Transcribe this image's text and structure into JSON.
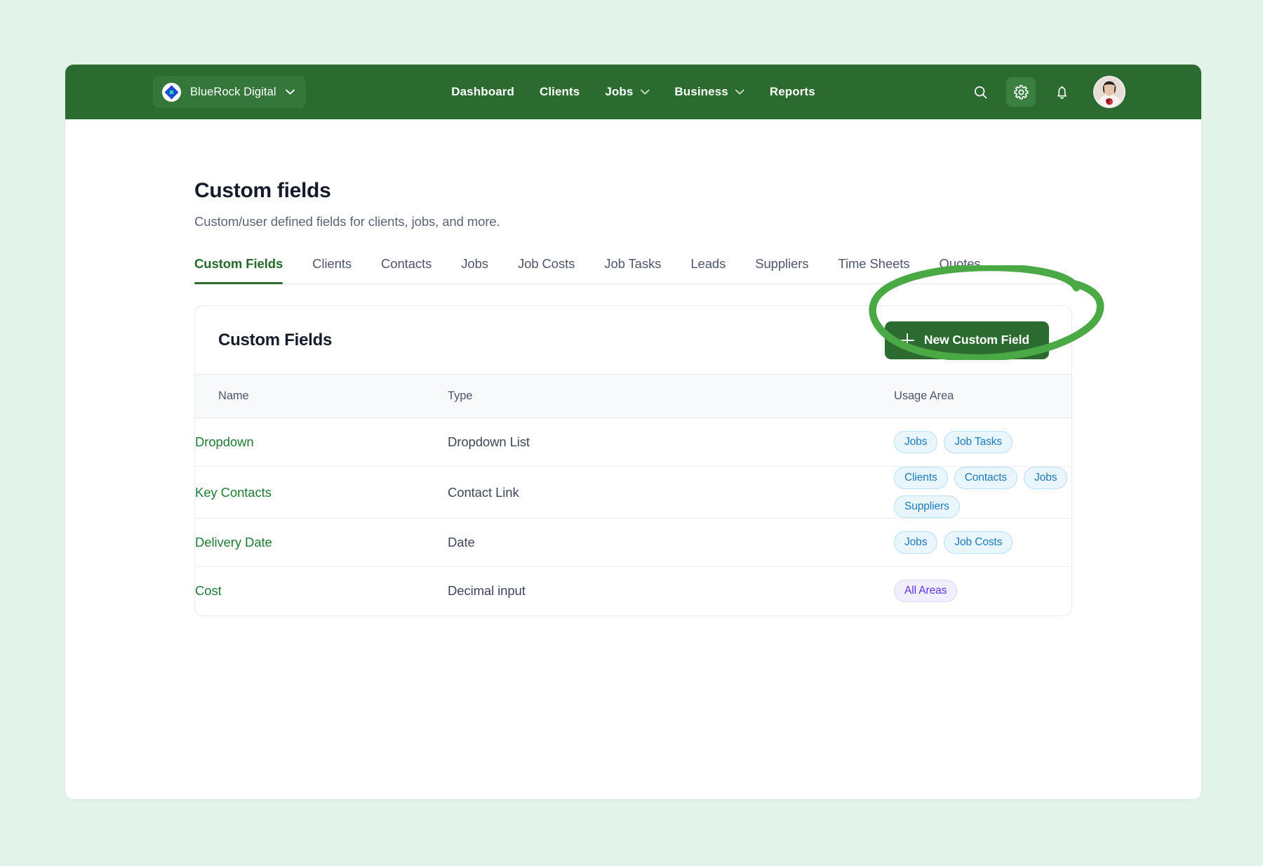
{
  "topbar": {
    "org": {
      "name": "BlueRock Digital",
      "chevron_icon": "chevron-down-icon",
      "logo_icon": "bluerock-logo-icon"
    },
    "nav": [
      {
        "label": "Dashboard",
        "has_dropdown": false
      },
      {
        "label": "Clients",
        "has_dropdown": false
      },
      {
        "label": "Jobs",
        "has_dropdown": true
      },
      {
        "label": "Business",
        "has_dropdown": true
      },
      {
        "label": "Reports",
        "has_dropdown": false
      }
    ],
    "actions": [
      {
        "name": "search-icon",
        "label": "Search",
        "active": false
      },
      {
        "name": "gear-icon",
        "label": "Settings",
        "active": true
      },
      {
        "name": "bell-icon",
        "label": "Notifications",
        "active": false
      }
    ],
    "avatar_label": "User profile"
  },
  "page": {
    "title": "Custom fields",
    "subtitle": "Custom/user defined fields for clients, jobs, and more."
  },
  "tabs": [
    {
      "label": "Custom Fields",
      "active": true
    },
    {
      "label": "Clients",
      "active": false
    },
    {
      "label": "Contacts",
      "active": false
    },
    {
      "label": "Jobs",
      "active": false
    },
    {
      "label": "Job Costs",
      "active": false
    },
    {
      "label": "Job Tasks",
      "active": false
    },
    {
      "label": "Leads",
      "active": false
    },
    {
      "label": "Suppliers",
      "active": false
    },
    {
      "label": "Time Sheets",
      "active": false
    },
    {
      "label": "Quotes",
      "active": false
    }
  ],
  "card": {
    "title": "Custom Fields",
    "new_button_label": "New Custom Field",
    "annotation": "hand-drawn green ellipse highlighting the New Custom Field button"
  },
  "table": {
    "columns": [
      "Name",
      "Type",
      "Usage Area"
    ],
    "rows": [
      {
        "name": "Dropdown",
        "type": "Dropdown List",
        "usage": [
          {
            "label": "Jobs",
            "tone": "blue"
          },
          {
            "label": "Job Tasks",
            "tone": "blue"
          }
        ]
      },
      {
        "name": "Key Contacts",
        "type": "Contact Link",
        "usage": [
          {
            "label": "Clients",
            "tone": "blue"
          },
          {
            "label": "Contacts",
            "tone": "blue"
          },
          {
            "label": "Jobs",
            "tone": "blue"
          },
          {
            "label": "Suppliers",
            "tone": "blue"
          }
        ]
      },
      {
        "name": "Delivery Date",
        "type": "Date",
        "usage": [
          {
            "label": "Jobs",
            "tone": "blue"
          },
          {
            "label": "Job Costs",
            "tone": "blue"
          }
        ]
      },
      {
        "name": "Cost",
        "type": "Decimal input",
        "usage": [
          {
            "label": "All Areas",
            "tone": "purple"
          }
        ]
      }
    ]
  },
  "colors": {
    "brand_green": "#2b6b2f",
    "topbar_green": "#2b6b2f",
    "active_icon_green": "#3c8041",
    "page_background": "#e2f3e9",
    "annotation_green": "#4aa845",
    "link_green": "#1f7a34",
    "badge_blue_bg": "#eaf6fd",
    "badge_blue_text": "#1a79b7",
    "badge_purple_bg": "#f1eefe",
    "badge_purple_text": "#5a33e0"
  }
}
